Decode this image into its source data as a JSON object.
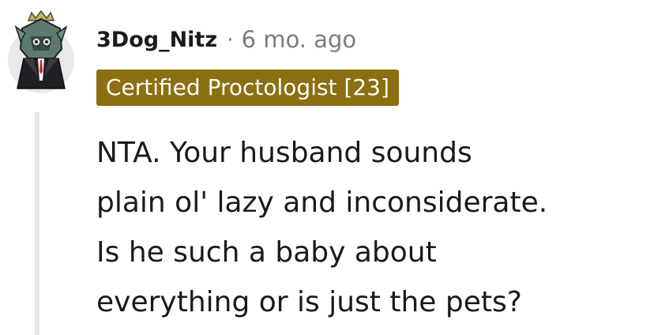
{
  "comment": {
    "username": "3Dog_Nitz",
    "separator": "·",
    "timestamp": "6 mo. ago",
    "flair": "Certified Proctologist [23]",
    "body_lines": [
      "NTA. Your husband sounds",
      "plain ol' lazy and inconsiderate.",
      "Is he such a baby about",
      "everything or is just the pets?"
    ]
  },
  "colors": {
    "flair_background": "#8b6f10",
    "text": "#1a1a1b",
    "muted": "#7c7c7c",
    "thread_line": "#e5e5e5"
  },
  "icons": {
    "avatar": "user-avatar"
  }
}
